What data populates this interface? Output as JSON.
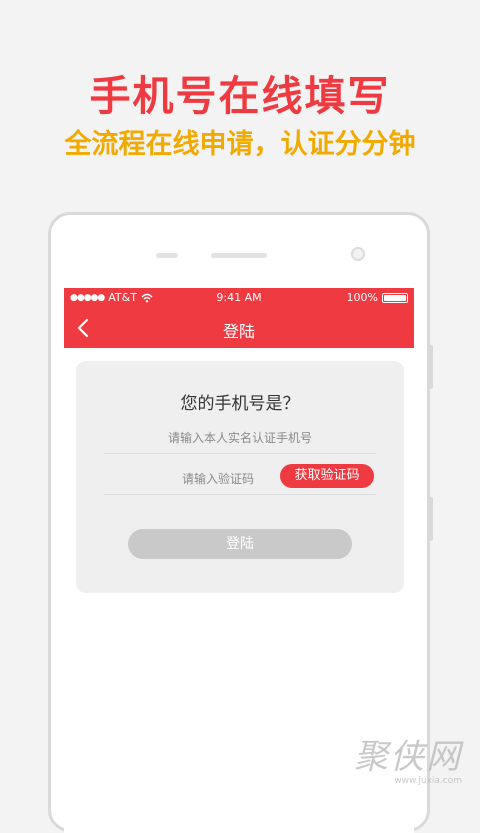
{
  "promo": {
    "headline": "手机号在线填写",
    "subline": "全流程在线申请，认证分分钟"
  },
  "status_bar": {
    "carrier": "AT&T",
    "time": "9:41 AM",
    "battery": "100%",
    "battery_level": 1.0
  },
  "navbar": {
    "back_icon": "chevron-left-icon",
    "title": "登陆"
  },
  "form": {
    "title": "您的手机号是？",
    "phone_placeholder": "请输入本人实名认证手机号",
    "phone_value": "",
    "code_placeholder": "请输入验证码",
    "code_value": "",
    "get_code_label": "获取验证码",
    "login_label": "登陆"
  },
  "watermark": {
    "main": "聚侠网",
    "sub": "www.juxia.com"
  },
  "colors": {
    "accent": "#ee3a40",
    "subline": "#f2a900",
    "disabled_button": "#c9c9c9",
    "card_bg": "#efefef"
  }
}
